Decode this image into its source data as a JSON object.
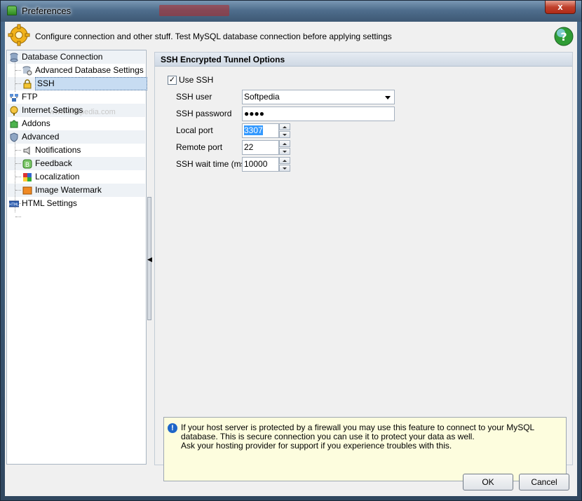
{
  "window": {
    "title": "Preferences",
    "close_label": "x"
  },
  "header": {
    "description": "Configure connection and other stuff. Test MySQL database connection before applying settings"
  },
  "tree": {
    "items": [
      {
        "label": "Database Connection",
        "icon": "database-icon"
      },
      {
        "label": "Advanced Database Settings",
        "icon": "database-settings-icon"
      },
      {
        "label": "SSH",
        "icon": "lock-icon",
        "selected": true
      },
      {
        "label": "FTP",
        "icon": "ftp-icon"
      },
      {
        "label": "Internet Settings",
        "icon": "internet-icon"
      },
      {
        "label": "Addons",
        "icon": "puzzle-icon"
      },
      {
        "label": "Advanced",
        "icon": "shield-icon"
      },
      {
        "label": "Notifications",
        "icon": "notification-icon"
      },
      {
        "label": "Feedback",
        "icon": "feedback-icon"
      },
      {
        "label": "Localization",
        "icon": "flag-icon"
      },
      {
        "label": "Image Watermark",
        "icon": "image-icon"
      },
      {
        "label": "HTML Settings",
        "icon": "html-icon"
      }
    ],
    "watermark": "www.softpedia.com"
  },
  "panel": {
    "title": "SSH Encrypted Tunnel Options",
    "use_ssh_label": "Use SSH",
    "use_ssh_checked": true,
    "check_mark": "✓",
    "fields": {
      "ssh_user_label": "SSH user",
      "ssh_user_value": "Softpedia",
      "ssh_password_label": "SSH password",
      "ssh_password_value": "●●●●",
      "local_port_label": "Local port",
      "local_port_value": "3307",
      "remote_port_label": "Remote port",
      "remote_port_value": "22",
      "wait_time_label": "SSH wait time (ms)",
      "wait_time_value": "10000"
    },
    "info": {
      "icon_glyph": "!",
      "line1": "If your host server is protected by a firewall you may use this feature to connect to your MySQL database. This is secure connection you can use it to protect your data as well.",
      "line2": "Ask your hosting provider for support if you experience troubles with this."
    }
  },
  "buttons": {
    "ok": "OK",
    "cancel": "Cancel"
  },
  "colors": {
    "selection": "#c7dcf2",
    "info_background": "#fdfdde",
    "titlebar": "#4f6e8d"
  }
}
